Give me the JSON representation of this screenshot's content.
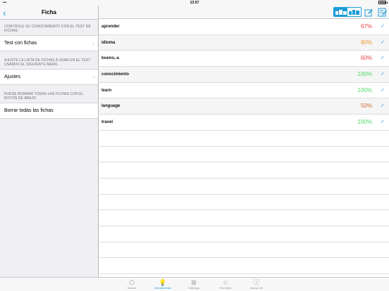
{
  "status": {
    "time": "13:57"
  },
  "sidebar": {
    "title": "Ficha",
    "notes": [
      "CONTROLE SU CONOCIMIENTO CON EL TEST DE FICHAS.",
      "AJUSTE LA LISTA DE FICHAS A USAR EN EL TEST USANDO EL SIGUIENTE MENÚ.",
      "PUEDE BORRAR TODAS LAS FICHAS CON EL BOTÓN DE ABAJO."
    ],
    "cells": [
      "Test con fichas",
      "Ajustes",
      "Borrar todas las fichas"
    ]
  },
  "words": [
    {
      "term": "aprender",
      "percent": "67%",
      "color": "#e8413c"
    },
    {
      "term": "idioma",
      "percent": "80%",
      "color": "#f0962a"
    },
    {
      "term": "bueno,-a",
      "percent": "60%",
      "color": "#e8413c"
    },
    {
      "term": "conocimiento",
      "percent": "100%",
      "color": "#4cd964"
    },
    {
      "term": "learn",
      "percent": "100%",
      "color": "#4cd964"
    },
    {
      "term": "language",
      "percent": "50%",
      "color": "#d9692b"
    },
    {
      "term": "travel",
      "percent": "100%",
      "color": "#4cd964"
    }
  ],
  "empty_rows": 10,
  "accent_color": "#1a9cd8",
  "tabs": [
    {
      "label": "Buscar",
      "icon": "search-icon",
      "active": false
    },
    {
      "label": "Herramientas",
      "icon": "lightbulb-icon",
      "active": true
    },
    {
      "label": "Catálogo",
      "icon": "catalog-icon",
      "active": false
    },
    {
      "label": "Favoritos",
      "icon": "star-icon",
      "active": false
    },
    {
      "label": "Acerca de",
      "icon": "info-icon",
      "active": false
    }
  ]
}
